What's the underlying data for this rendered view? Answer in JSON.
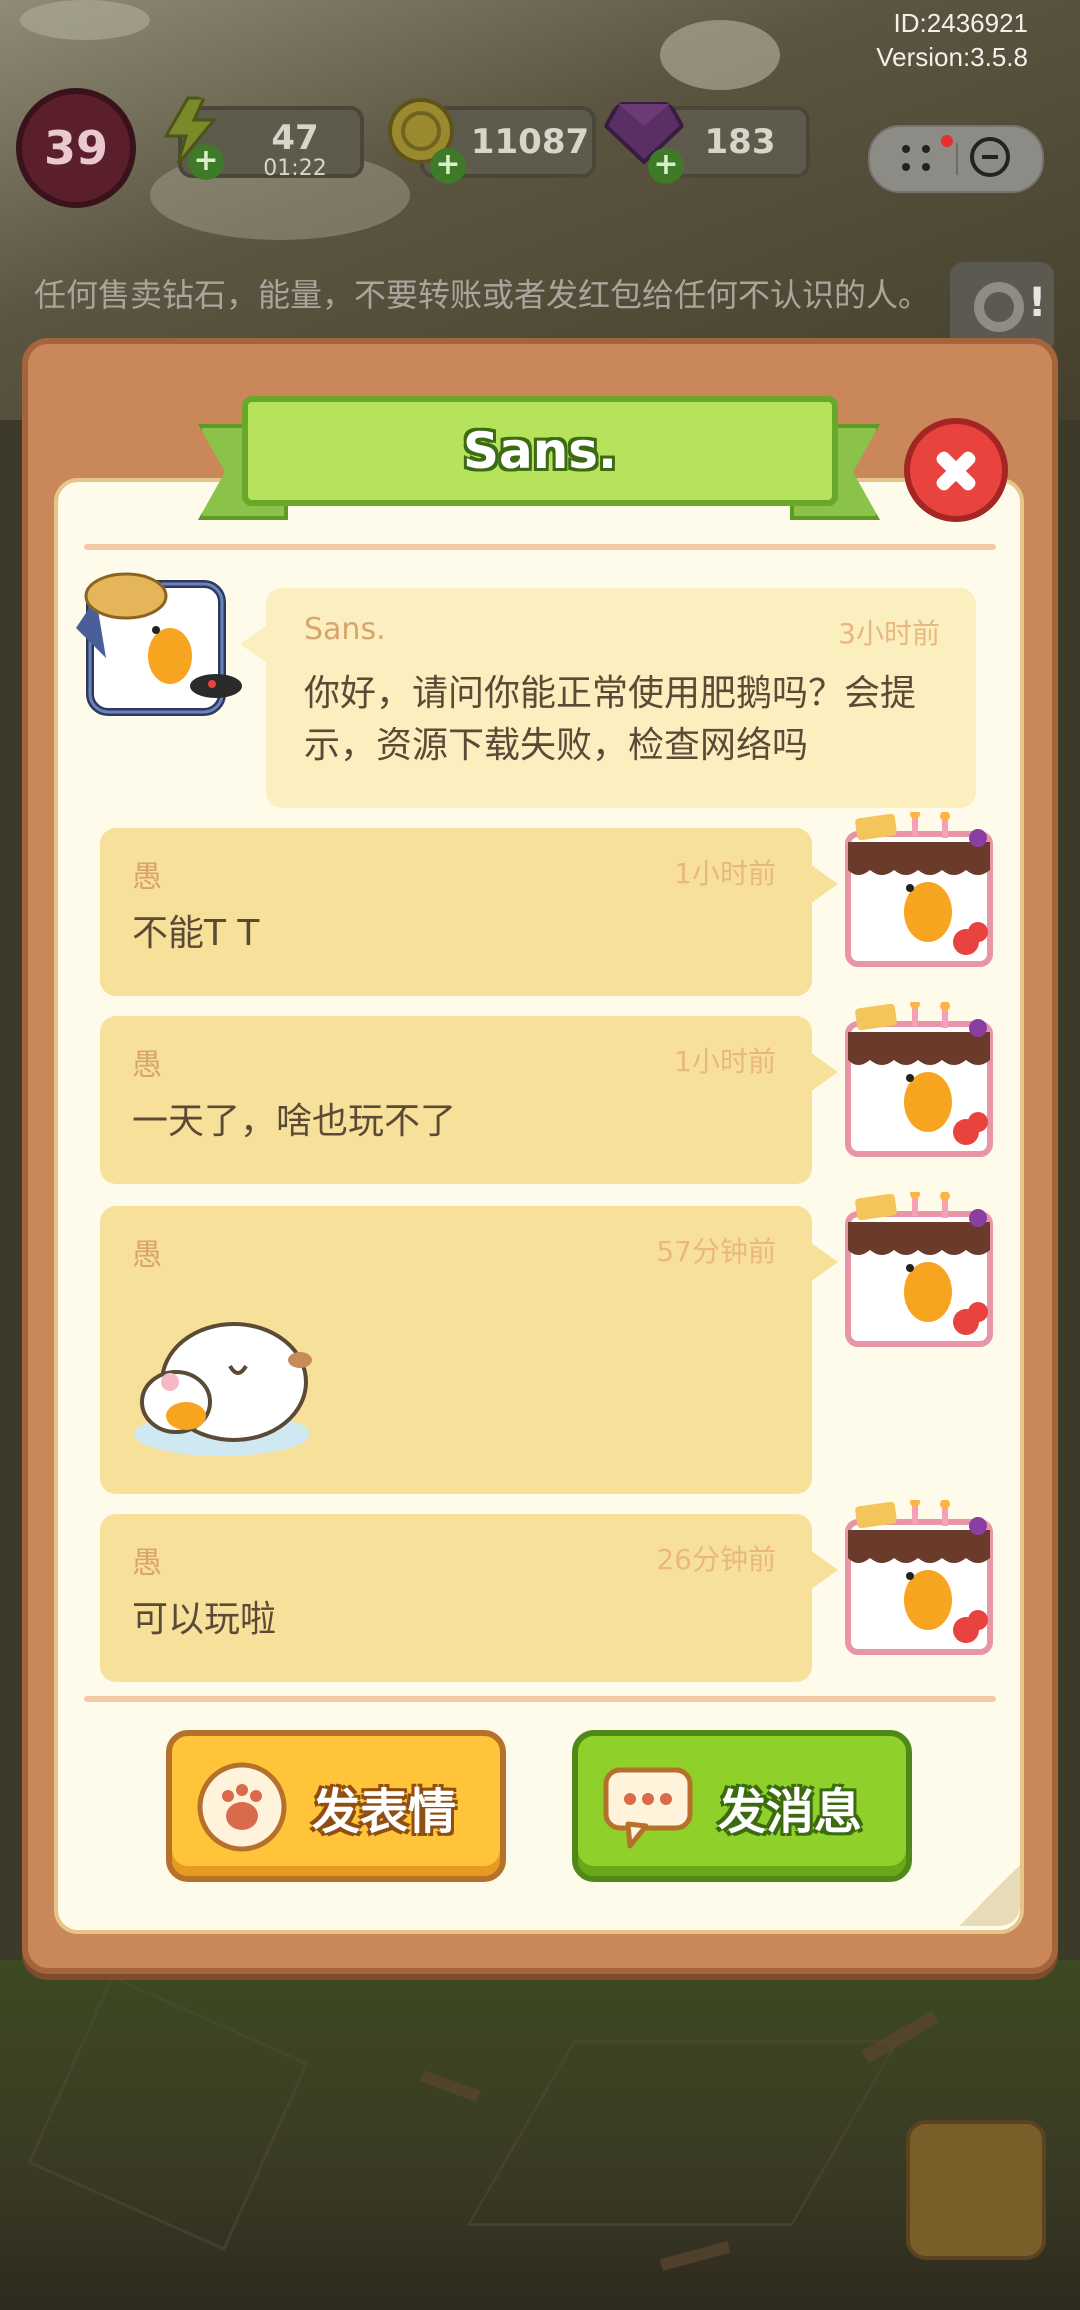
{
  "hud": {
    "id_text": "ID:2436921",
    "version_text": "Version:3.5.8",
    "level": "39",
    "energy": {
      "value": "47",
      "timer": "01:22",
      "icon": "lightning-icon"
    },
    "coins": {
      "value": "11087",
      "icon": "coin-icon"
    },
    "gems": {
      "value": "183",
      "icon": "gem-icon"
    },
    "plus_symbol": "+"
  },
  "warning_text": "任何售卖钻石，能量，不要转账或者发红包给任何不认识的人。",
  "dialog": {
    "title": "Sans.",
    "messages": [
      {
        "side": "left",
        "sender": "Sans.",
        "time": "3小时前",
        "text": "你好，请问你能正常使用肥鹅吗？会提示，资源下载失败，检查网络吗"
      },
      {
        "side": "right",
        "sender": "愚",
        "time": "1小时前",
        "text": "不能T T"
      },
      {
        "side": "right",
        "sender": "愚",
        "time": "1小时前",
        "text": "一天了，啥也玩不了"
      },
      {
        "side": "right",
        "sender": "愚",
        "time": "57分钟前",
        "text": "",
        "sticker": "sleeping-goose-sticker"
      },
      {
        "side": "right",
        "sender": "愚",
        "time": "26分钟前",
        "text": "可以玩啦"
      }
    ],
    "buttons": {
      "emoji_label": "发表情",
      "message_label": "发消息"
    }
  },
  "colors": {
    "dialog_frame": "#c9875a",
    "paper": "#fffbea",
    "title_ribbon": "#b7e35c",
    "close_button": "#e8433f",
    "bubble_self": "#f7e19a",
    "bubble_other": "#fbefc0",
    "emoji_button": "#ffc43a",
    "message_button": "#8fd12a"
  }
}
